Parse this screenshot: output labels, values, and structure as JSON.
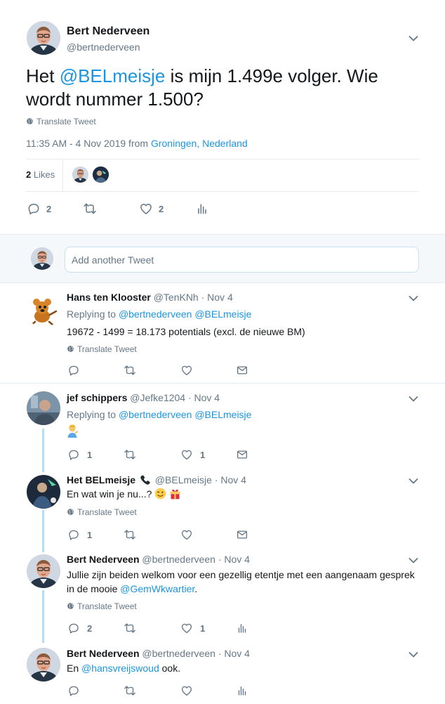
{
  "main_tweet": {
    "author_name": "Bert Nederveen",
    "author_handle": "@bertnederveen",
    "text_prefix": "Het ",
    "mention": "@BELmeisje",
    "text_line1_suffix": " is mijn 1.499e volger. Wie",
    "text_line2": "wordt nummer 1.500?",
    "translate": "Translate Tweet",
    "time_prefix": "11:35 AM - 4 Nov 2019 from ",
    "location": "Groningen, Nederland",
    "likes_count": "2",
    "likes_label": "Likes",
    "reply_count": "2",
    "like_count": "2"
  },
  "composer": {
    "placeholder": "Add another Tweet"
  },
  "replies": [
    {
      "name": "Hans ten Klooster",
      "meta": "@TenKNh · Nov 4",
      "replying_label": "Replying to ",
      "replying_to": "@bertnederveen @BELmeisje",
      "text": "19672 - 1499 = 18.173 potentials (excl. de nieuwe BM)",
      "translate": "Translate Tweet"
    },
    {
      "name": "jef schippers",
      "meta": "@Jefke1204 · Nov 4",
      "replying_label": "Replying to ",
      "replying_to": "@bertnederveen @BELmeisje",
      "reply_count": "1",
      "like_count": "1"
    },
    {
      "name": "Het BELmeisje",
      "meta": "@BELmeisje · Nov 4",
      "text": "En wat win je nu...?",
      "translate": "Translate Tweet",
      "reply_count": "1"
    },
    {
      "name": "Bert Nederveen",
      "meta": "@bertnederveen · Nov 4",
      "text_line1": "Jullie zijn beiden welkom voor een gezellig etentje met een aangenaam gesprek",
      "text_line2_prefix": "in de mooie ",
      "mention": "@GemWkwartier",
      "text_line2_suffix": ".",
      "translate": "Translate Tweet",
      "reply_count": "2",
      "like_count": "1"
    },
    {
      "name": "Bert Nederveen",
      "meta": "@bertnederveen · Nov 4",
      "text_prefix": "En ",
      "mention": "@hansvreijswoud",
      "text_suffix": " ook."
    }
  ],
  "colors": {
    "link": "#1b95e0",
    "muted": "#657786",
    "divider": "#e6ecf0",
    "thread": "#b1dff7"
  },
  "icons": [
    "reply-icon",
    "retweet-icon",
    "like-icon",
    "analytics-icon",
    "dm-icon",
    "globe-icon",
    "chevron-down-icon"
  ]
}
